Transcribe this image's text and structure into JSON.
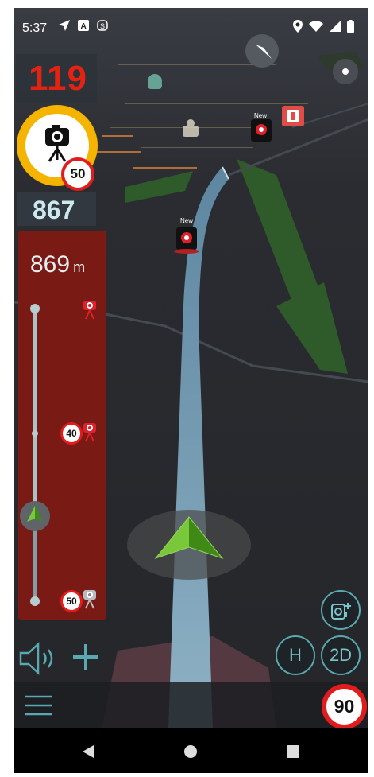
{
  "status_bar": {
    "time": "5:37",
    "icons_left": [
      "navigation-arrow-icon",
      "font-a-icon",
      "app-s-icon"
    ],
    "icons_right": [
      "location-pin-icon",
      "wifi-icon",
      "cellular-icon",
      "battery-icon"
    ]
  },
  "current_speed": "119",
  "camera_alert": {
    "icon": "speed-camera-icon",
    "speed_limit": "50"
  },
  "camera_distance": "867",
  "route_panel": {
    "distance": "869",
    "unit": "m",
    "items": [
      {
        "icon": "speed-camera-icon",
        "limit": ""
      },
      {
        "icon": "speed-camera-icon",
        "limit": "40"
      },
      {
        "icon": "speed-camera-icon",
        "limit": "50"
      }
    ]
  },
  "map_labels": {
    "camera_new_1": "New",
    "camera_new_2": "New"
  },
  "controls": {
    "heading_button": "H",
    "view_mode_button": "2D",
    "add_camera_icon": "add-camera-icon",
    "sound_icon": "speaker-icon",
    "zoom_in_icon": "plus-icon",
    "menu_icon": "hamburger-menu-icon"
  },
  "road_speed_limit": "90",
  "colors": {
    "alert_red": "#e32212",
    "camera_ring": "#f4b400",
    "panel_red": "#7a1a14",
    "route_blue": "#8fb6c8",
    "accent_teal": "#5aa8b0",
    "arrow_green": "#5fa31e"
  }
}
